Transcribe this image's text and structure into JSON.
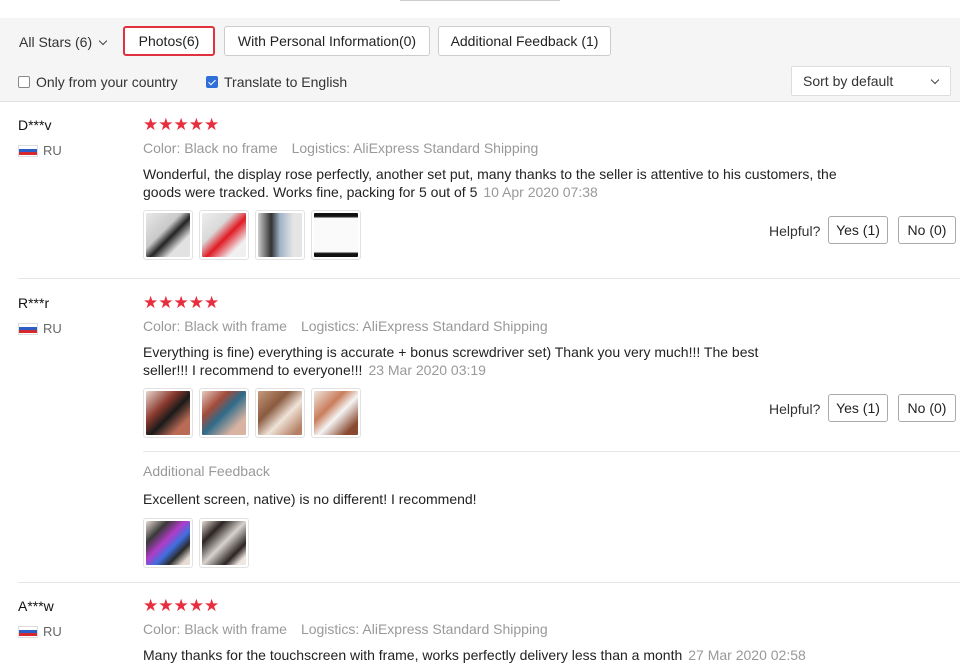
{
  "filters": {
    "all_stars": "All Stars (6)",
    "buttons": [
      {
        "label": "Photos(6)",
        "active": true
      },
      {
        "label": "With Personal Information(0)",
        "active": false
      },
      {
        "label": "Additional Feedback (1)",
        "active": false
      }
    ],
    "only_country": {
      "label": "Only from your country",
      "checked": false
    },
    "translate": {
      "label": "Translate to English",
      "checked": true
    },
    "sort": "Sort by default"
  },
  "reviews": [
    {
      "user": "D***v",
      "country": "RU",
      "stars": "★★★★★",
      "color": "Color: Black no frame",
      "logistics": "Logistics: AliExpress Standard Shipping",
      "text": "Wonderful, the display rose perfectly, another set put, many thanks to the seller is attentive to his customers, the goods were tracked. Works fine, packing for 5 out of 5",
      "date": "10 Apr 2020 07:38",
      "helpful": "Helpful?",
      "yes": "Yes (1)",
      "no": "No (0)"
    },
    {
      "user": "R***r",
      "country": "RU",
      "stars": "★★★★★",
      "color": "Color: Black with frame",
      "logistics": "Logistics: AliExpress Standard Shipping",
      "text": "Everything is fine) everything is accurate + bonus screwdriver set) Thank you very much!!! The best seller!!! I recommend to everyone!!!",
      "date": "23 Mar 2020 03:19",
      "helpful": "Helpful?",
      "yes": "Yes (1)",
      "no": "No (0)",
      "additional_title": "Additional Feedback",
      "additional_text": "Excellent screen, native) is no different! I recommend!"
    },
    {
      "user": "A***w",
      "country": "RU",
      "stars": "★★★★★",
      "color": "Color: Black with frame",
      "logistics": "Logistics: AliExpress Standard Shipping",
      "text": "Many thanks for the touchscreen with frame, works perfectly delivery less than a month",
      "date": "27 Mar 2020 02:58"
    }
  ],
  "colors": {
    "accent_red": "#e62e3e",
    "checkbox_blue": "#2f6fd6"
  }
}
